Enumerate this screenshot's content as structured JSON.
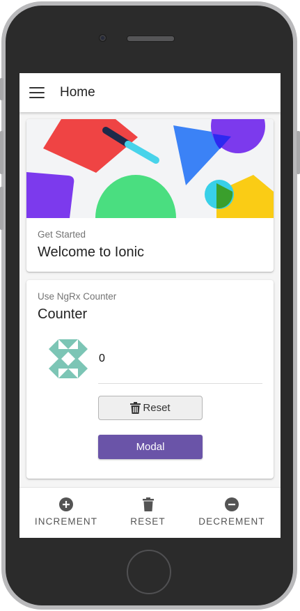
{
  "toolbar": {
    "title": "Home",
    "menu_icon": "menu-icon"
  },
  "welcome_card": {
    "subtitle": "Get Started",
    "title": "Welcome to Ionic"
  },
  "counter_card": {
    "subtitle": "Use NgRx Counter",
    "title": "Counter",
    "value": "0",
    "reset_label": "Reset",
    "modal_label": "Modal",
    "reset_icon": "trash-icon",
    "avatar": "identicon-avatar"
  },
  "tabs": [
    {
      "label": "INCREMENT",
      "icon": "add-circle-icon"
    },
    {
      "label": "RESET",
      "icon": "trash-icon"
    },
    {
      "label": "DECREMENT",
      "icon": "remove-circle-icon"
    }
  ],
  "colors": {
    "accent": "#6a54a8",
    "hero_red": "#ef4444",
    "hero_blue": "#3b82f6",
    "hero_purple": "#7c3aed",
    "hero_green": "#4ade80",
    "hero_yellow": "#facc15",
    "hero_cyan": "#38d0e8",
    "identicon": "#7cc5b5"
  }
}
